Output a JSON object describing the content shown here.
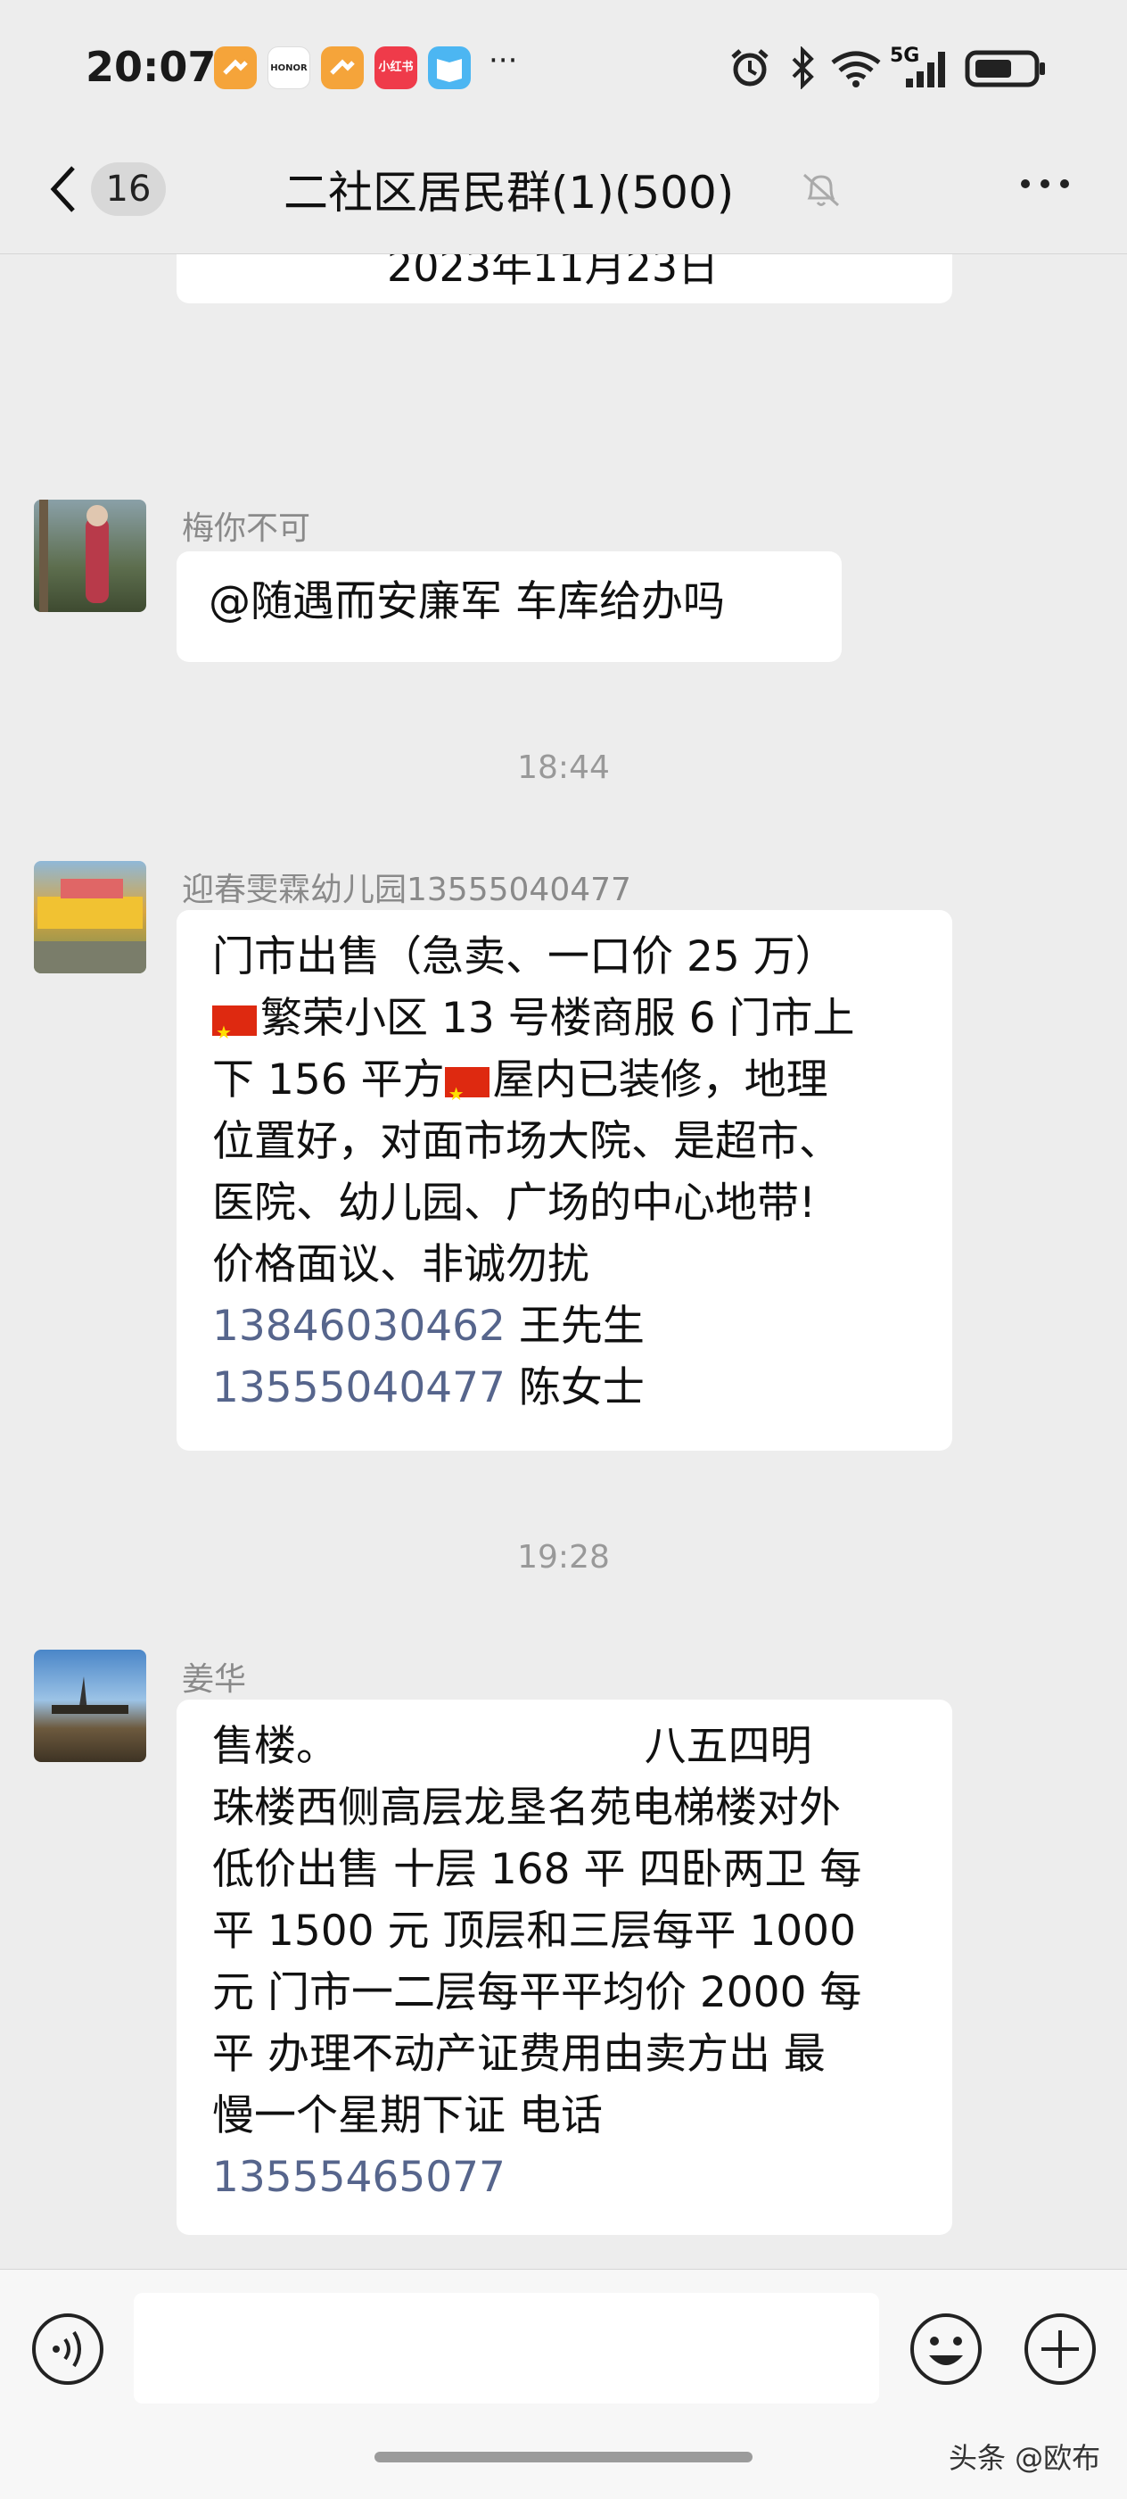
{
  "status_bar": {
    "time": "20:07",
    "app_icons": [
      "app-icon",
      "honor-icon",
      "app-icon",
      "xiaohongshu-icon",
      "reader-icon"
    ],
    "honor_label": "HONOR",
    "xhs_label": "小红书",
    "more": "···",
    "network": "5G"
  },
  "header": {
    "back_count": "16",
    "title": "二社区居民群(1)(500)"
  },
  "messages": {
    "partial_date": "2023年11月23日",
    "m1": {
      "sender": "梅你不可",
      "text": "@随遇而安廉军  车库给办吗"
    },
    "ts1": "18:44",
    "m2": {
      "sender": "迎春雯霖幼儿园13555040477",
      "lines": [
        "门市出售（急卖、一口价 25 万）",
        "繁荣小区 13 号楼商服 6 门市上",
        "下 156 平方",
        "屋内已装修，地理",
        "位置好，对面市场大院、是超市、",
        "医院、幼儿园、广场的中心地带!",
        "价格面议、非诚勿扰"
      ],
      "phone1": "13846030462",
      "name1": " 王先生",
      "phone2": "13555040477",
      "name2": " 陈女士"
    },
    "ts2": "19:28",
    "m3": {
      "sender": "姜华",
      "lines": [
        "售楼。                       八五四明",
        "珠楼西侧高层龙垦名苑电梯楼对外",
        "低价出售 十层 168 平  四卧两卫 每",
        "平 1500 元 顶层和三层每平 1000",
        "元 门市一二层每平平均价 2000 每",
        "平 办理不动产证费用由卖方出  最",
        "慢一个星期下证 电话"
      ],
      "phone": "13555465077"
    }
  },
  "watermark": "头条 @欧布"
}
